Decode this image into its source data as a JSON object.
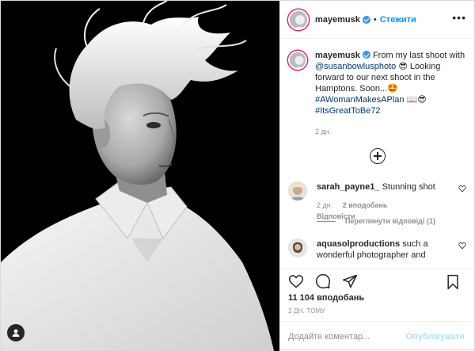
{
  "post": {
    "username": "mayemusk",
    "follow_label": "Стежити",
    "separator": "•",
    "more_label": "•••"
  },
  "caption": {
    "username": "mayemusk",
    "line_1": "From my last shoot with",
    "mention": "@susanbowlusphoto",
    "line_2": "Looking forward to our next shoot in the Hamptons. Soon...",
    "hashtag_1": "#AWomanMakesAPlan",
    "hashtag_2": "#ItsGreatToBe72",
    "age": "2 дн."
  },
  "comments": [
    {
      "username": "sarah_payne1_",
      "text": "Stunning shot",
      "age": "2 дн.",
      "likes": "2 вподобань",
      "reply": "Відповісти",
      "view_replies": "Переглянути відповіді (1)"
    },
    {
      "username": "aquasolproductions",
      "text": "such a wonderful photographer and"
    }
  ],
  "stats": {
    "likes": "11 104 вподобань",
    "post_age": "2 ДН. ТОМУ"
  },
  "comment_box": {
    "placeholder": "Додайте коментар...",
    "publish_label": "Опублікувати"
  },
  "colors": {
    "accent": "#0095f6",
    "verified": "#3897f0",
    "muted": "#8e8e8e"
  },
  "icons": {
    "heart": "heart-icon",
    "comment": "comment-icon",
    "share": "share-icon",
    "save": "bookmark-icon",
    "user_tag": "user-tag-icon",
    "load_more": "plus-circle-icon",
    "more": "more-options-icon"
  }
}
